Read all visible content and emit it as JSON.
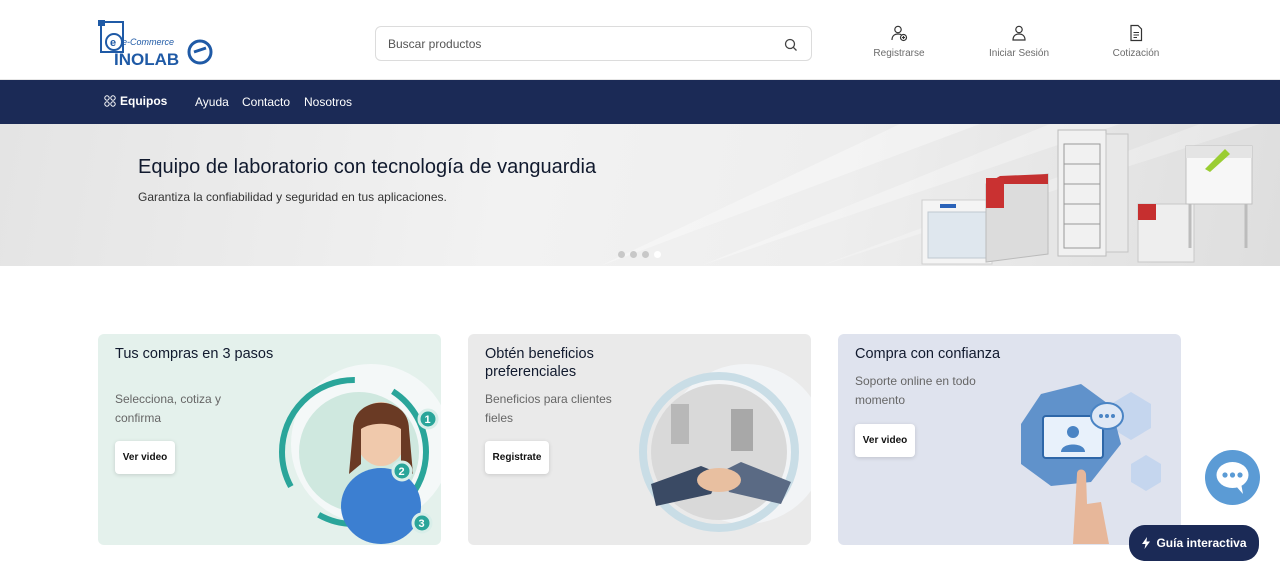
{
  "logo": {
    "line1": "e-Commerce",
    "line2": "INOLAB"
  },
  "search": {
    "placeholder": "Buscar productos"
  },
  "header_actions": [
    {
      "label": "Registrarse",
      "icon": "user-plus-icon"
    },
    {
      "label": "Iniciar Sesión",
      "icon": "user-icon"
    },
    {
      "label": "Cotización",
      "icon": "document-icon"
    }
  ],
  "nav": {
    "equipos": "Equipos",
    "ayuda": "Ayuda",
    "contacto": "Contacto",
    "nosotros": "Nosotros"
  },
  "hero": {
    "title": "Equipo de laboratorio con tecnología de vanguardia",
    "subtitle": "Garantiza la confiabilidad y seguridad en tus aplicaciones.",
    "slides": 4,
    "active_slide": 4
  },
  "cards": [
    {
      "title": "Tus compras en 3 pasos",
      "desc": "Selecciona, cotiza y confirma",
      "button": "Ver video",
      "steps": [
        "1",
        "2",
        "3"
      ],
      "bg": "#e4f1ec"
    },
    {
      "title": "Obtén beneficios preferenciales",
      "desc": "Beneficios para clientes fieles",
      "button": "Registrate",
      "bg": "#eaeaea"
    },
    {
      "title": "Compra con confianza",
      "desc": "Soporte online en todo momento",
      "button": "Ver video",
      "bg": "#dfe3ee"
    }
  ],
  "chat_icon": "chat-bubble-icon",
  "guide": {
    "label": "Guía interactiva",
    "icon": "lightning-icon"
  },
  "colors": {
    "nav_bg": "#1b2a56",
    "brand_blue": "#1f5aa6",
    "chat_bg": "#5b9bd5",
    "accent_teal": "#2aa59a"
  }
}
